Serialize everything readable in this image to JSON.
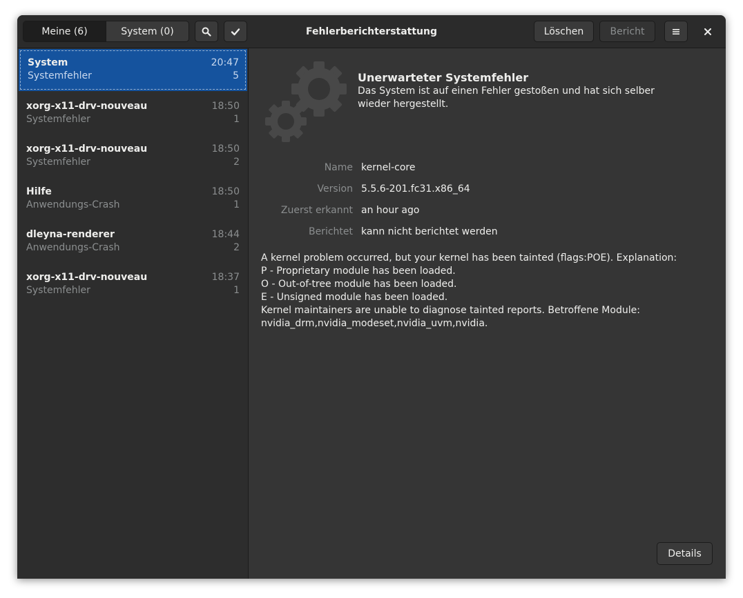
{
  "header": {
    "tabs": [
      {
        "label": "Meine (6)",
        "active": true
      },
      {
        "label": "System (0)",
        "active": false
      }
    ],
    "search_icon": "search-icon",
    "select_icon": "checkmark-icon",
    "title": "Fehlerberichterstattung",
    "delete_label": "Löschen",
    "report_label": "Bericht",
    "menu_icon": "hamburger-menu-icon",
    "close_icon": "close-icon"
  },
  "problems": [
    {
      "name": "System",
      "time": "20:47",
      "kind": "Systemfehler",
      "count": "5",
      "selected": true
    },
    {
      "name": "xorg-x11-drv-nouveau",
      "time": "18:50",
      "kind": "Systemfehler",
      "count": "1"
    },
    {
      "name": "xorg-x11-drv-nouveau",
      "time": "18:50",
      "kind": "Systemfehler",
      "count": "2"
    },
    {
      "name": "Hilfe",
      "time": "18:50",
      "kind": "Anwendungs-Crash",
      "count": "1"
    },
    {
      "name": "dleyna-renderer",
      "time": "18:44",
      "kind": "Anwendungs-Crash",
      "count": "2"
    },
    {
      "name": "xorg-x11-drv-nouveau",
      "time": "18:37",
      "kind": "Systemfehler",
      "count": "1"
    }
  ],
  "detail": {
    "icon": "gears-icon",
    "title": "Unerwarteter Systemfehler",
    "description": "Das System ist auf einen Fehler gestoßen und hat sich selber wieder hergestellt.",
    "fields": [
      {
        "label": "Name",
        "value": "kernel-core"
      },
      {
        "label": "Version",
        "value": "5.5.6-201.fc31.x86_64"
      },
      {
        "label": "Zuerst erkannt",
        "value": "an hour ago"
      },
      {
        "label": "Berichtet",
        "value": "kann nicht berichtet werden"
      }
    ],
    "explanation": "A kernel problem occurred, but your kernel has been tainted (flags:POE). Explanation:\nP - Proprietary module has been loaded.\nO - Out-of-tree module has been loaded.\nE - Unsigned module has been loaded.\nKernel maintainers are unable to diagnose tainted reports. Betroffene Module:\nnvidia_drm,nvidia_modeset,nvidia_uvm,nvidia.",
    "details_label": "Details"
  },
  "colors": {
    "selection": "#15539e",
    "window_bg": "#353535",
    "sidebar_bg": "#2d2d2d",
    "headerbar_bg": "#2b2b2b",
    "dim_text": "#8b8e8f"
  }
}
